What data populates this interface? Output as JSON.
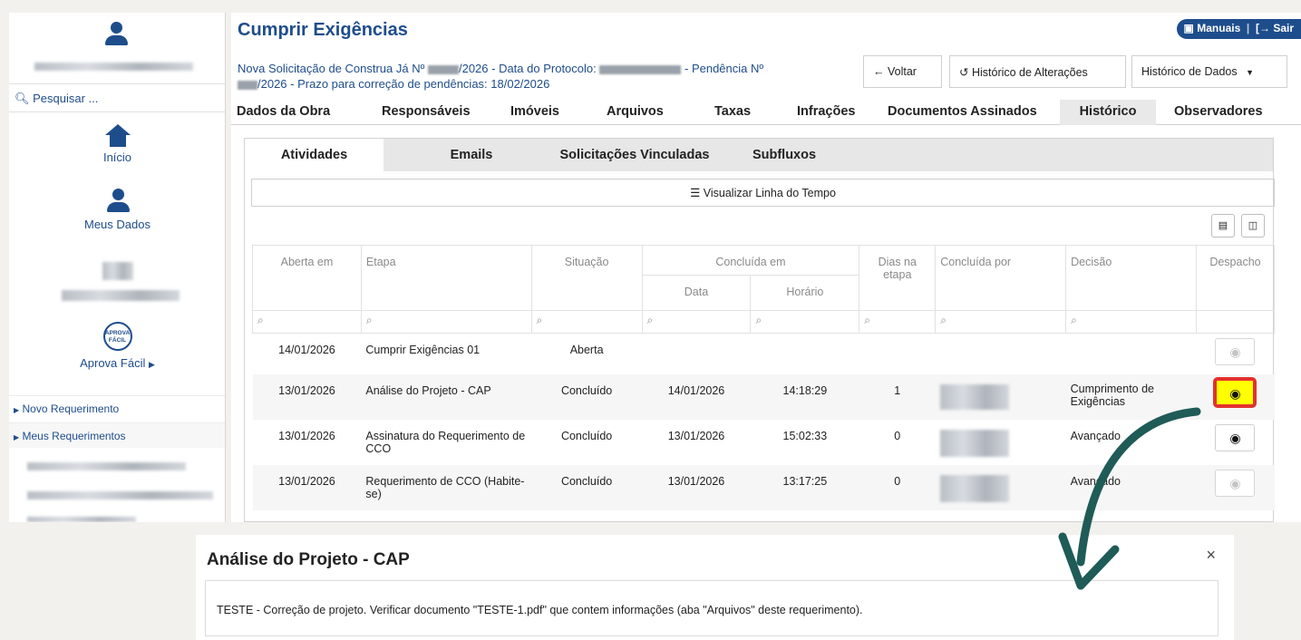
{
  "sidebar": {
    "search_placeholder": "Pesquisar ...",
    "home_label": "Início",
    "my_data_label": "Meus Dados",
    "aprova_logo_text": "APROVA FÁCIL",
    "aprova_label": "Aprova Fácil",
    "links": [
      "Novo Requerimento",
      "Meus Requerimentos"
    ]
  },
  "header": {
    "title": "Cumprir Exigências",
    "manuais_label": "Manuais",
    "sair_label": "Sair",
    "subtitle_line1_a": "Nova Solicitação de Construa Já Nº",
    "subtitle_line1_b": "/2026 - Data do Protocolo:",
    "subtitle_line1_c": "- Pendência Nº",
    "subtitle_line2": "/2026 - Prazo para correção de pendências: 18/02/2026",
    "back_button": "Voltar",
    "change_history_button": "Histórico de Alterações",
    "data_history_button": "Histórico de Dados"
  },
  "main_tabs": [
    "Dados da Obra",
    "Responsáveis",
    "Imóveis",
    "Arquivos",
    "Taxas",
    "Infrações",
    "Documentos Assinados",
    "Histórico",
    "Observadores"
  ],
  "inner_tabs": [
    "Atividades",
    "Emails",
    "Solicitações Vinculadas",
    "Subfluxos"
  ],
  "timeline_button": "Visualizar Linha do Tempo",
  "table": {
    "headers": {
      "opened": "Aberta em",
      "stage": "Etapa",
      "status": "Situação",
      "concluded": "Concluída em",
      "date": "Data",
      "time": "Horário",
      "days": "Dias na etapa",
      "concluded_by": "Concluída por",
      "decision": "Decisão",
      "dispatch": "Despacho"
    },
    "rows": [
      {
        "opened": "14/01/2026",
        "stage": "Cumprir Exigências 01",
        "status": "Aberta",
        "date": "",
        "time": "",
        "days": "",
        "decision": ""
      },
      {
        "opened": "13/01/2026",
        "stage": "Análise do Projeto - CAP",
        "status": "Concluído",
        "date": "14/01/2026",
        "time": "14:18:29",
        "days": "1",
        "decision": "Cumprimento de Exigências"
      },
      {
        "opened": "13/01/2026",
        "stage": "Assinatura do Requerimento de CCO",
        "status": "Concluído",
        "date": "13/01/2026",
        "time": "15:02:33",
        "days": "0",
        "decision": "Avançado"
      },
      {
        "opened": "13/01/2026",
        "stage": "Requerimento de CCO (Habite-se)",
        "status": "Concluído",
        "date": "13/01/2026",
        "time": "13:17:25",
        "days": "0",
        "decision": "Avançado"
      }
    ]
  },
  "modal": {
    "title": "Análise do Projeto - CAP",
    "close": "×",
    "body": "TESTE - Correção de projeto. Verificar documento \"TESTE-1.pdf\" que contem informações (aba \"Arquivos\" deste requerimento)."
  },
  "colors": {
    "brand": "#1e4d8c",
    "highlight": "#ffff00",
    "annotation_red": "#e3322e",
    "arrow": "#1f5b57"
  }
}
